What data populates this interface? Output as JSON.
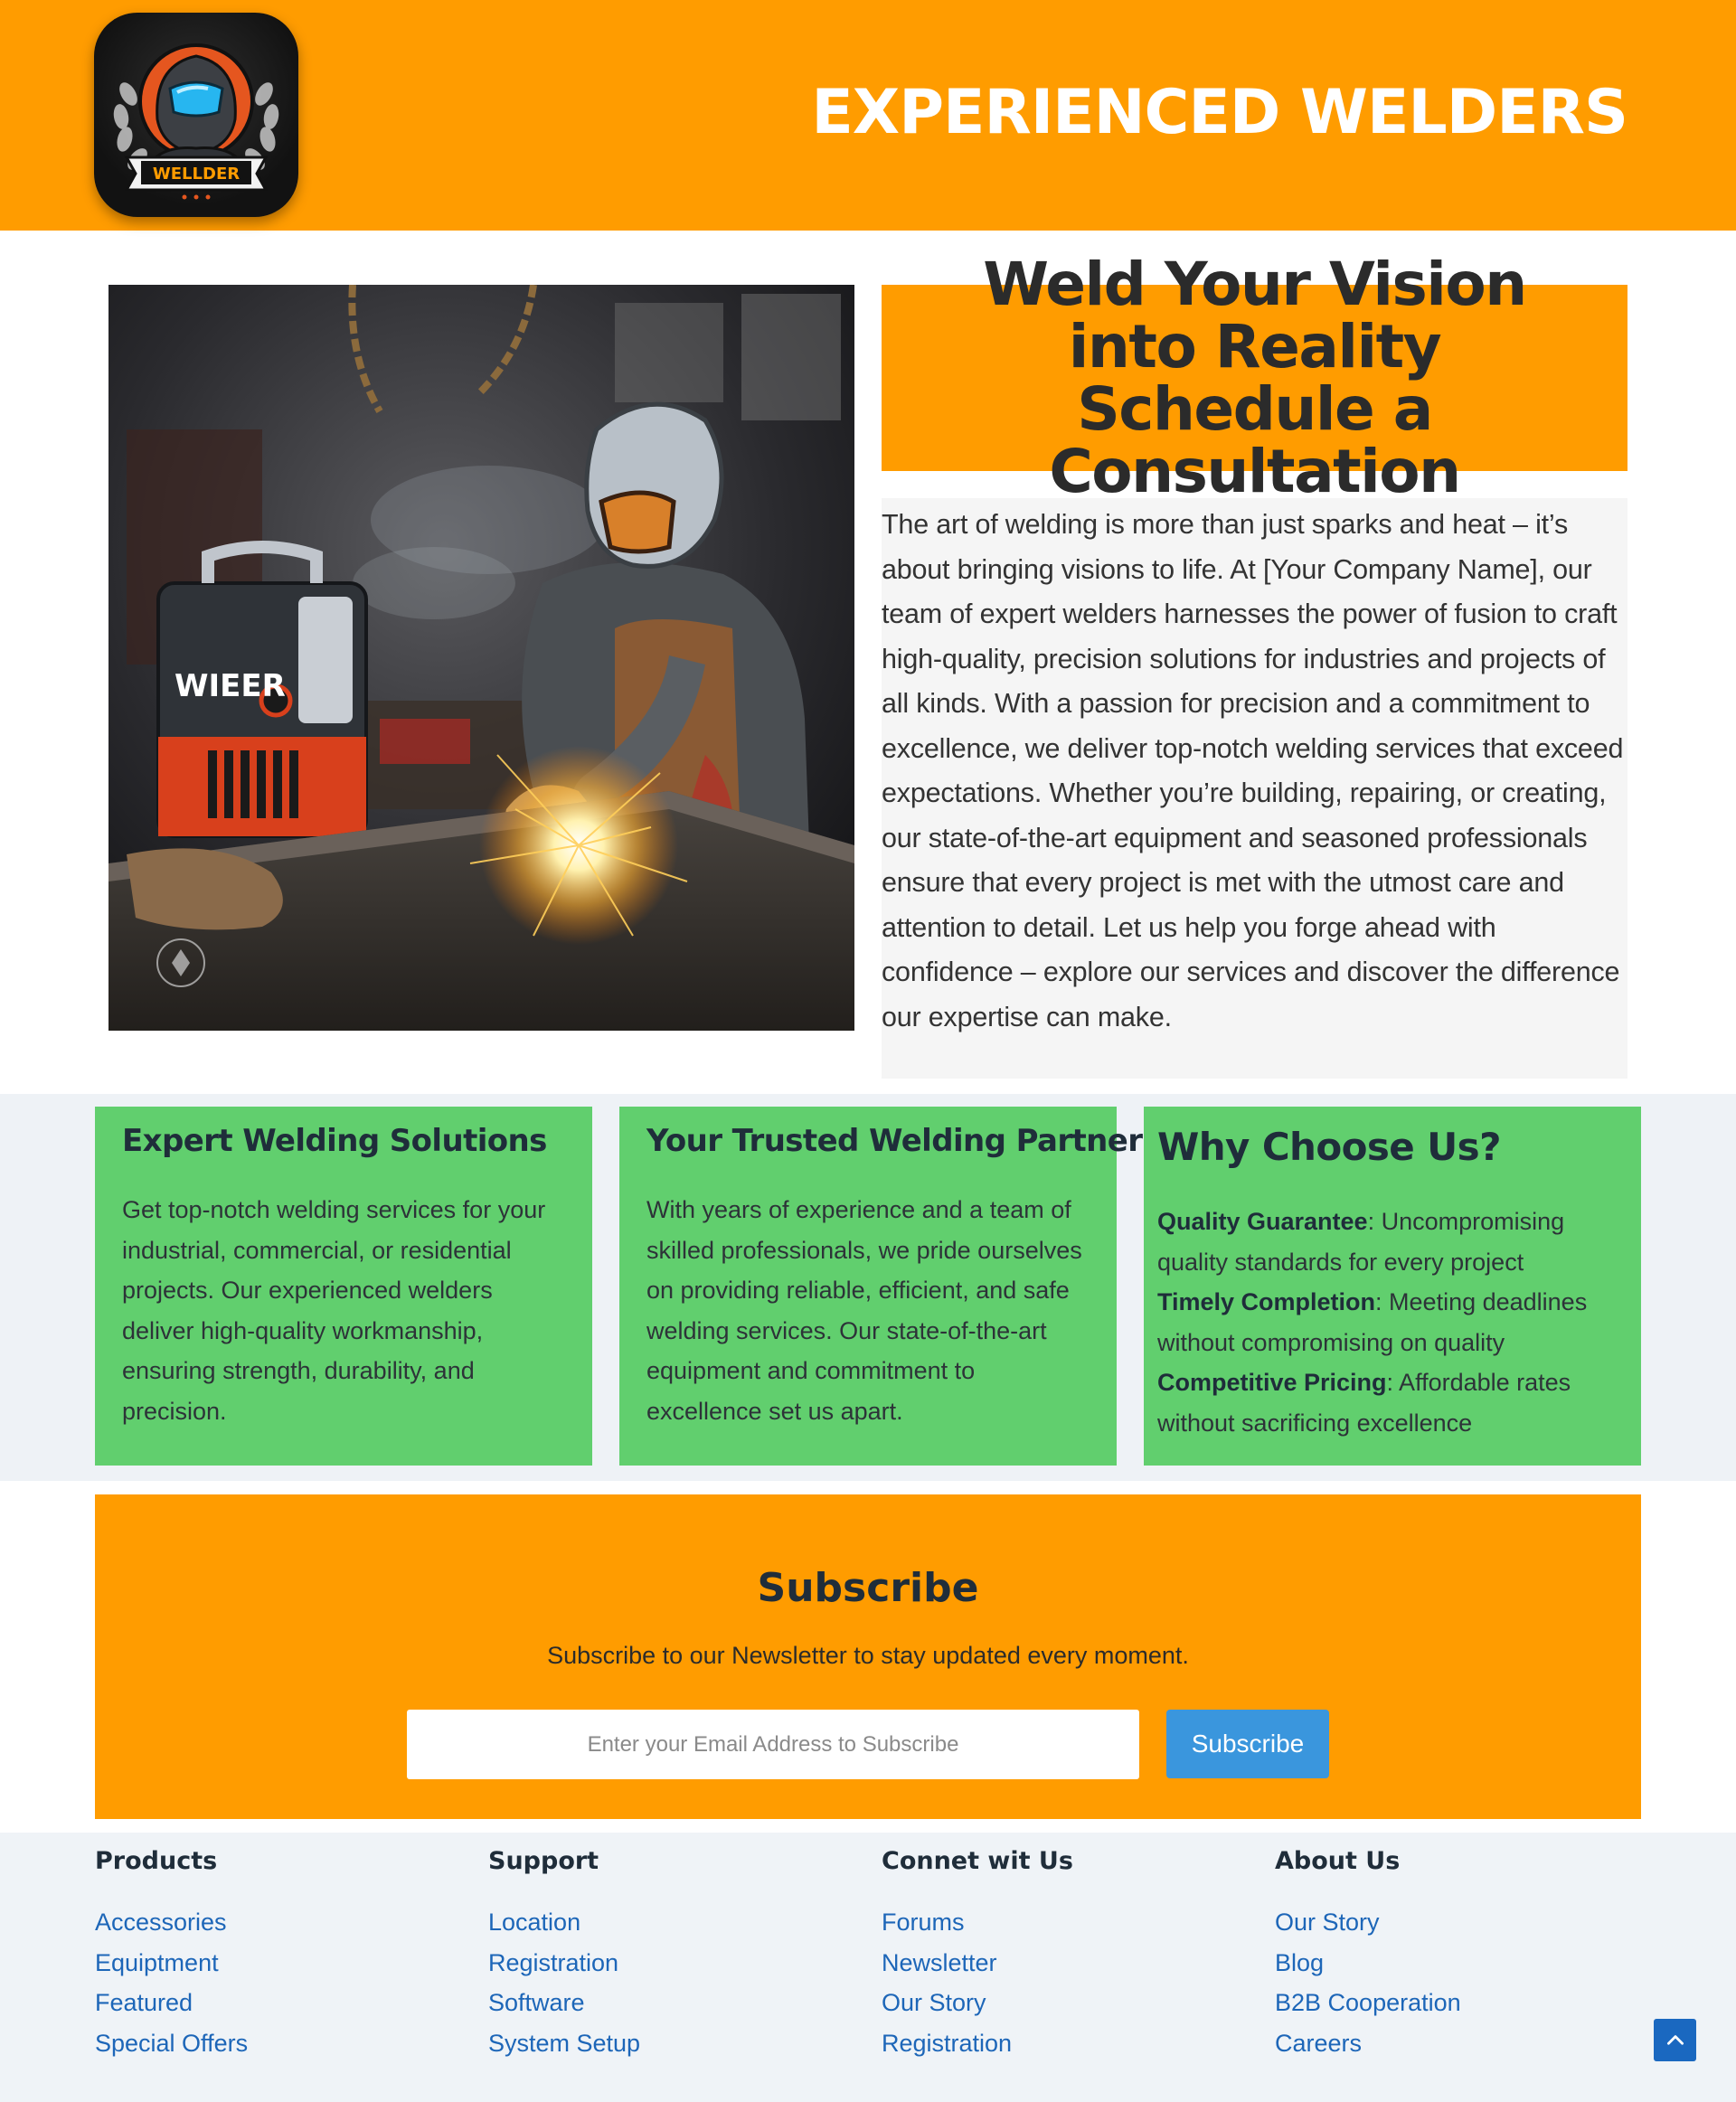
{
  "header": {
    "logo_alt": "WELLDER",
    "logo_text": "WELLDER",
    "title": "EXPERIENCED WELDERS"
  },
  "hero": {
    "image_alt": "welder working on a metal table with a welding machine",
    "heading": "Weld Your Vision into Reality Schedule a Consultation",
    "body": "The art of welding is more than just sparks and heat – it’s about bringing visions to life. At [Your Company Name], our team of expert welders harnesses the power of fusion to craft high-quality, precision solutions for industries and projects of all kinds. With a passion for precision and a commitment to excellence, we deliver top-notch welding services that exceed expectations. Whether you’re building, repairing, or creating, our state-of-the-art equipment and seasoned professionals ensure that every project is met with the utmost care and attention to detail. Let us help you forge ahead with confidence – explore our services and discover the difference our expertise can make.",
    "machine_label": "WIEER"
  },
  "features": {
    "card1": {
      "title": "Expert Welding Solutions",
      "text": "Get top-notch welding services for your industrial, commercial, or residential projects. Our experienced welders deliver high-quality workmanship, ensuring strength, durability, and precision."
    },
    "card2": {
      "title": "Your Trusted Welding Partner",
      "text": "With years of experience and a team of skilled professionals, we pride ourselves on providing reliable, efficient, and safe welding services. Our state-of-the-art equipment and commitment to excellence set us apart."
    },
    "card3": {
      "title": "Why Choose Us?",
      "items": [
        {
          "label": "Quality Guarantee",
          "text": ": Uncompromising quality standards for every project"
        },
        {
          "label": "Timely Completion",
          "text": ": Meeting deadlines without compromising on quality"
        },
        {
          "label": "Competitive Pricing",
          "text": ": Affordable rates without sacrificing excellence"
        }
      ]
    }
  },
  "subscribe": {
    "title": "Subscribe",
    "subtitle": "Subscribe to our Newsletter to stay updated every moment.",
    "input_placeholder": "Enter your Email Address to Subscribe",
    "button_label": "Subscribe"
  },
  "footer": {
    "columns": [
      {
        "heading": "Products",
        "links": [
          "Accessories",
          "Equiptment",
          "Featured",
          "Special Offers"
        ]
      },
      {
        "heading": "Support",
        "links": [
          "Location",
          "Registration",
          "Software",
          "System Setup"
        ]
      },
      {
        "heading": "Connet wit Us",
        "links": [
          "Forums",
          "Newsletter",
          "Our Story",
          "Registration"
        ]
      },
      {
        "heading": "About Us",
        "links": [
          "Our Story",
          "Blog",
          "B2B Cooperation",
          "Careers"
        ]
      }
    ]
  },
  "colors": {
    "brand_orange": "#ff9c00",
    "card_green": "#61cf6e",
    "button_blue": "#3a96dd",
    "link_blue": "#1d66b8",
    "scroll_button": "#1a68c0"
  },
  "icons": {
    "scroll_top": "chevron-up-icon",
    "logo": "welder-helmet-logo"
  }
}
